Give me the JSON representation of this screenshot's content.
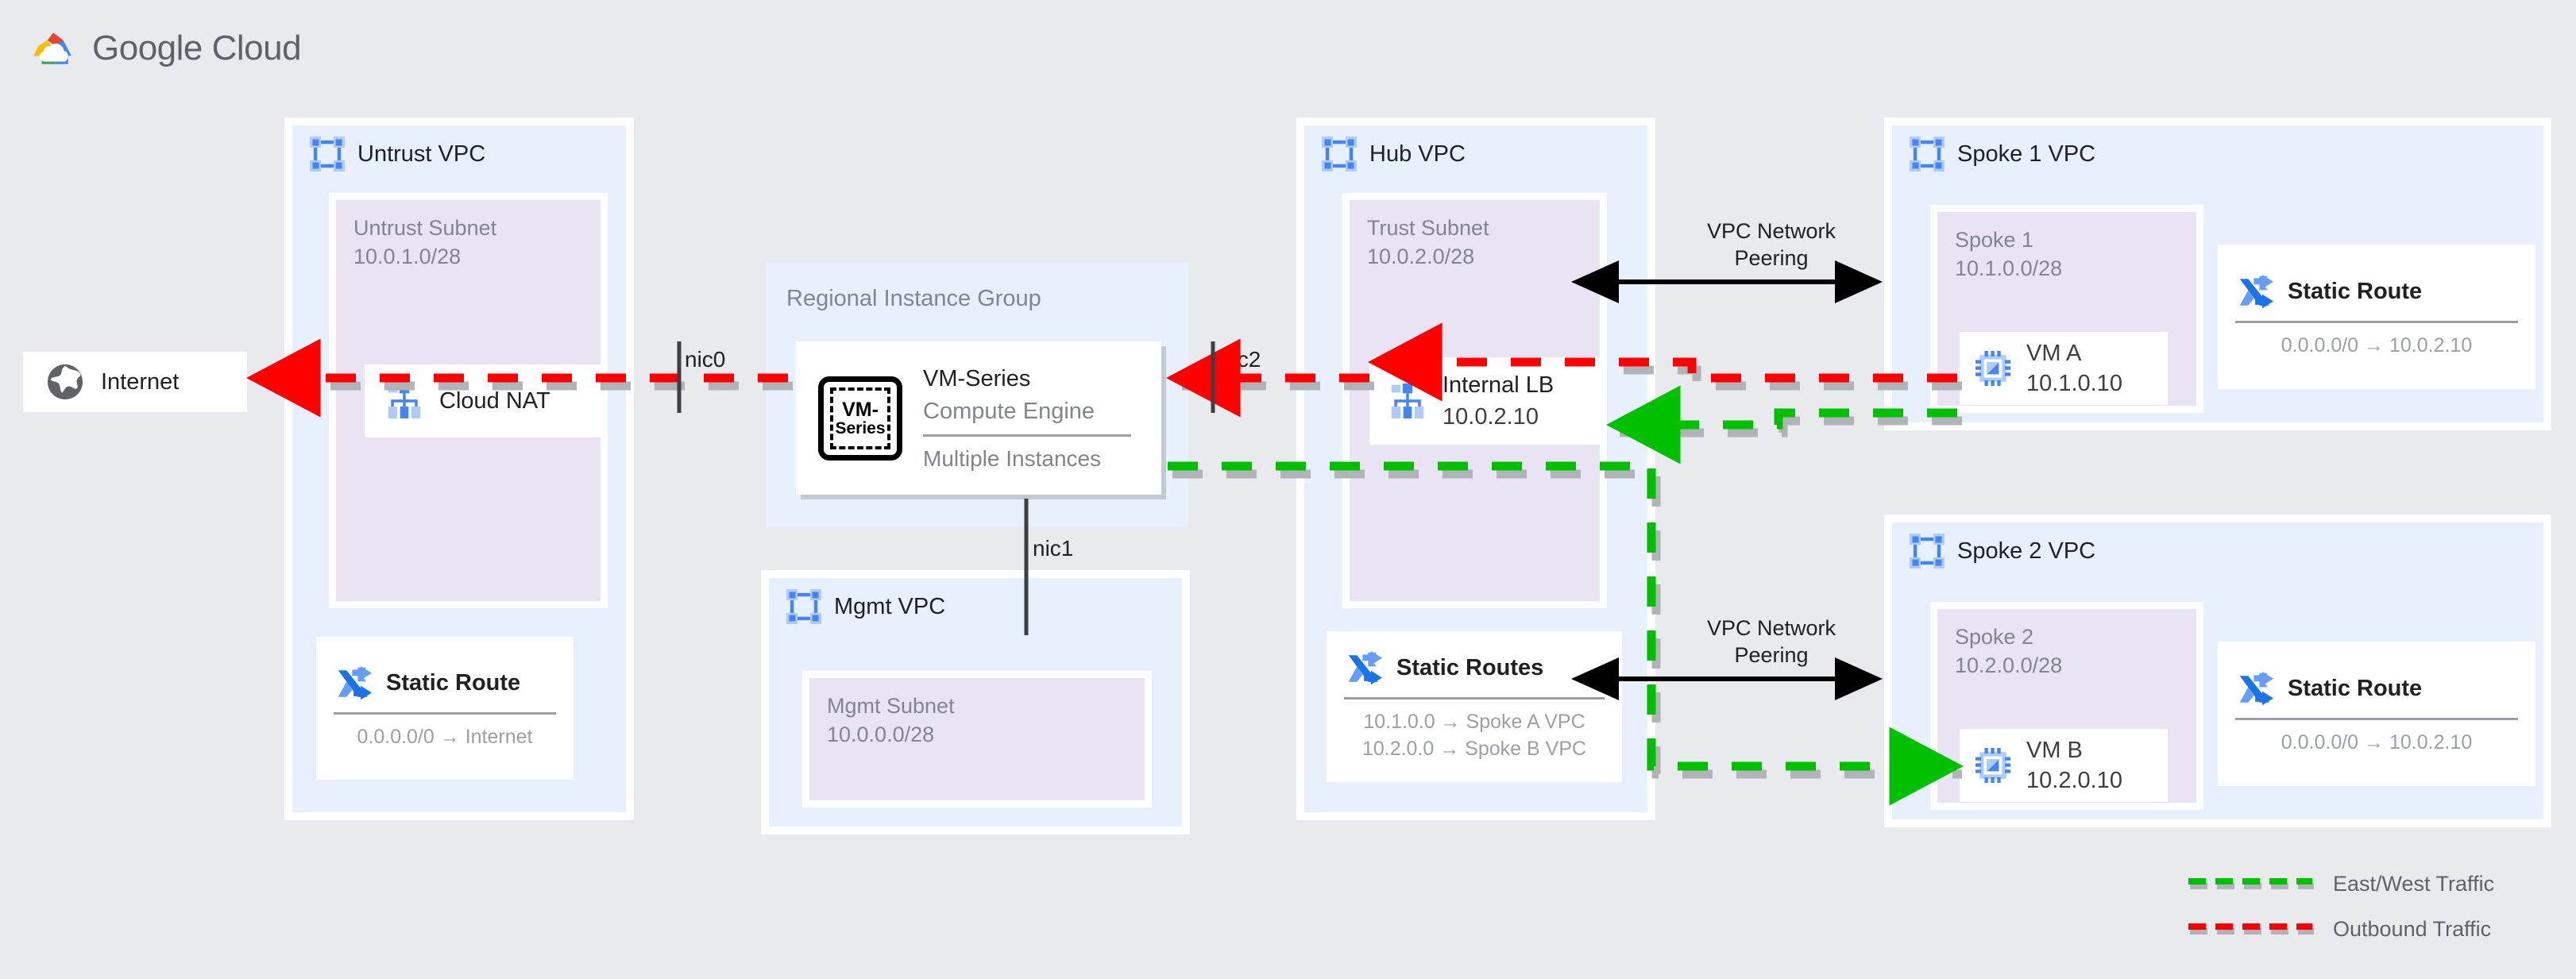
{
  "header": {
    "title": "Google Cloud",
    "logo": "google-cloud-logo"
  },
  "colors": {
    "background": "#e8eaed",
    "vpc_fill": "#e8f0fe",
    "subnet_fill": "#e9e3f3",
    "card_fill": "#ffffff",
    "accent_blue": "#4285f4",
    "east_west_traffic": "#00c000",
    "outbound_traffic": "#ff0000",
    "shadow_grey": "#b0b4b8",
    "text_dark": "#202124",
    "text_grey": "#80868b"
  },
  "internet": {
    "label": "Internet",
    "icon": "globe-icon"
  },
  "untrust_vpc": {
    "name": "Untrust VPC",
    "icon": "vpc-icon",
    "subnet": {
      "label": "Untrust Subnet\n10.0.1.0/28"
    },
    "cloud_nat": {
      "label": "Cloud NAT",
      "icon": "cloud-nat-icon"
    },
    "static_route": {
      "title": "Static Route",
      "icon": "static-route-icon",
      "rules": "0.0.0.0/0 → Internet"
    }
  },
  "regional_instance_group": {
    "label": "Regional Instance Group",
    "vm_series": {
      "icon": "vm-series-icon",
      "icon_text_line1": "VM-",
      "icon_text_line2": "Series",
      "title": "VM-Series",
      "subtitle": "Compute Engine",
      "footer": "Multiple Instances"
    },
    "nics": {
      "nic0": "nic0",
      "nic1": "nic1",
      "nic2": "nic2"
    }
  },
  "mgmt_vpc": {
    "name": "Mgmt VPC",
    "icon": "vpc-icon",
    "subnet": {
      "label": "Mgmt Subnet\n10.0.0.0/28"
    }
  },
  "hub_vpc": {
    "name": "Hub VPC",
    "icon": "vpc-icon",
    "subnet": {
      "label": "Trust Subnet\n10.0.2.0/28"
    },
    "internal_lb": {
      "title": "Internal LB",
      "subtitle": "10.0.2.10",
      "icon": "load-balancer-icon"
    },
    "static_routes": {
      "title": "Static Routes",
      "icon": "static-route-icon",
      "rules": "10.1.0.0 → Spoke A VPC\n10.2.0.0 → Spoke B VPC"
    }
  },
  "spoke1_vpc": {
    "name": "Spoke 1 VPC",
    "icon": "vpc-icon",
    "subnet": {
      "label": "Spoke 1\n10.1.0.0/28"
    },
    "vm": {
      "title": "VM A",
      "subtitle": "10.1.0.10",
      "icon": "vm-chip-icon"
    },
    "static_route": {
      "title": "Static Route",
      "icon": "static-route-icon",
      "rules": "0.0.0.0/0 → 10.0.2.10"
    }
  },
  "spoke2_vpc": {
    "name": "Spoke 2 VPC",
    "icon": "vpc-icon",
    "subnet": {
      "label": "Spoke 2\n10.2.0.0/28"
    },
    "vm": {
      "title": "VM B",
      "subtitle": "10.2.0.10",
      "icon": "vm-chip-icon"
    },
    "static_route": {
      "title": "Static Route",
      "icon": "static-route-icon",
      "rules": "0.0.0.0/0 → 10.0.2.10"
    }
  },
  "peering": {
    "top_label": "VPC Network\nPeering",
    "bottom_label": "VPC Network\nPeering"
  },
  "legend": {
    "items": [
      {
        "label": "East/West Traffic",
        "color": "#00c000"
      },
      {
        "label": "Outbound Traffic",
        "color": "#ff0000"
      }
    ]
  }
}
